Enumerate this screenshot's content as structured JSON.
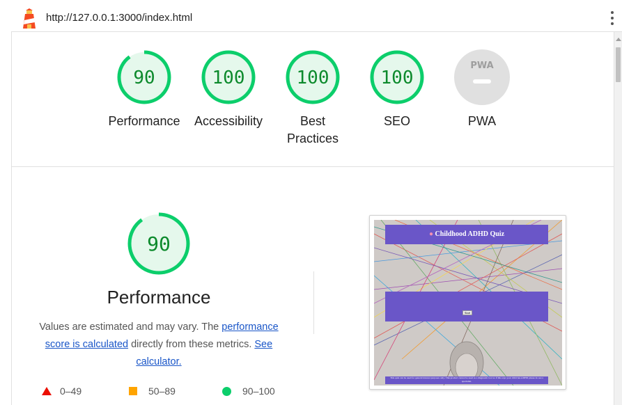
{
  "topbar": {
    "url": "http://127.0.0.1:3000/index.html",
    "menu_icon": "kebab-menu-icon"
  },
  "gauges": [
    {
      "label": "Performance",
      "score": "90",
      "fraction": 0.9,
      "type": "score"
    },
    {
      "label": "Accessibility",
      "score": "100",
      "fraction": 1.0,
      "type": "score"
    },
    {
      "label": "Best Practices",
      "score": "100",
      "fraction": 1.0,
      "type": "score"
    },
    {
      "label": "SEO",
      "score": "100",
      "fraction": 1.0,
      "type": "score"
    },
    {
      "label": "PWA",
      "badge_text": "PWA",
      "type": "pwa"
    }
  ],
  "performance": {
    "score": "90",
    "fraction": 0.9,
    "title": "Performance",
    "desc_prefix": "Values are estimated and may vary. The ",
    "desc_link1": "performance score is calculated",
    "desc_mid": " directly from these metrics. ",
    "desc_link2": "See calculator."
  },
  "legend": [
    {
      "range": "0–49",
      "shape": "triangle",
      "color": "#eb0f00"
    },
    {
      "range": "50–89",
      "shape": "square",
      "color": "#ffa400"
    },
    {
      "range": "90–100",
      "shape": "circle",
      "color": "#0cce6b"
    }
  ],
  "screenshot": {
    "header_title": "Childhood ADHD Quiz",
    "button_label": "Start",
    "footer_text": "This quiz can be used for general interest purposes only. This product cannot be used as a diagnostic tool so if this says your child has ADHD please do see a specialist."
  },
  "colors": {
    "pass_green": "#0cce6b",
    "pass_text": "#0c8a2c",
    "pass_bg": "#e5f8ec",
    "pwa_gray": "#e0e0e0",
    "accent_purple": "#6a56c8",
    "link_blue": "#1a56c8"
  }
}
